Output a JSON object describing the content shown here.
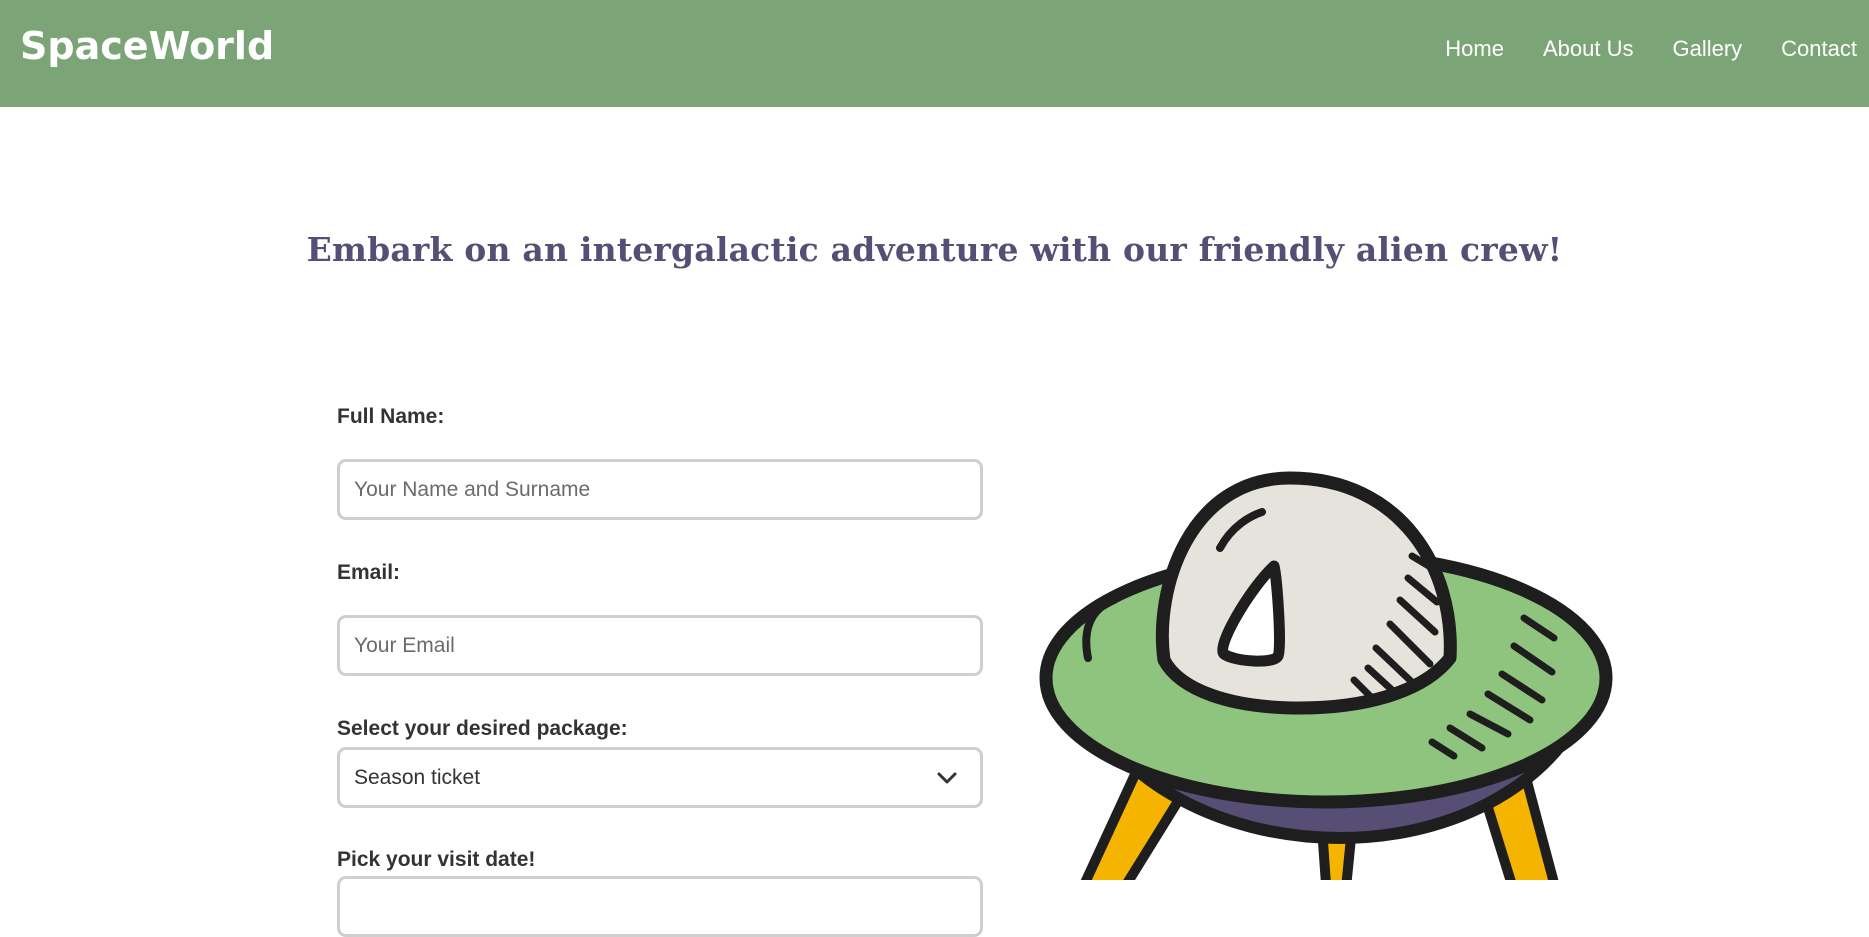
{
  "header": {
    "logo": "SpaceWorld",
    "nav": [
      {
        "label": "Home"
      },
      {
        "label": "About Us"
      },
      {
        "label": "Gallery"
      },
      {
        "label": "Contact"
      }
    ]
  },
  "hero": {
    "headline": "Embark on an intergalactic adventure with our friendly alien crew!"
  },
  "form": {
    "name": {
      "label": "Full Name:",
      "placeholder": "Your Name and Surname"
    },
    "email": {
      "label": "Email:",
      "placeholder": "Your Email"
    },
    "package": {
      "label": "Select your desired package:",
      "selected": "Season ticket"
    },
    "date": {
      "label": "Pick your visit date!"
    }
  },
  "icons": {
    "dropdown": "chevron-down-icon",
    "illustration": "ufo-illustration"
  },
  "colors": {
    "header_bg": "#7ba576",
    "headline": "#574e75",
    "ufo_saucer": "#8fc47f",
    "ufo_dome": "#e5e3dc",
    "ufo_base": "#574e75",
    "ufo_legs": "#f5b400"
  }
}
